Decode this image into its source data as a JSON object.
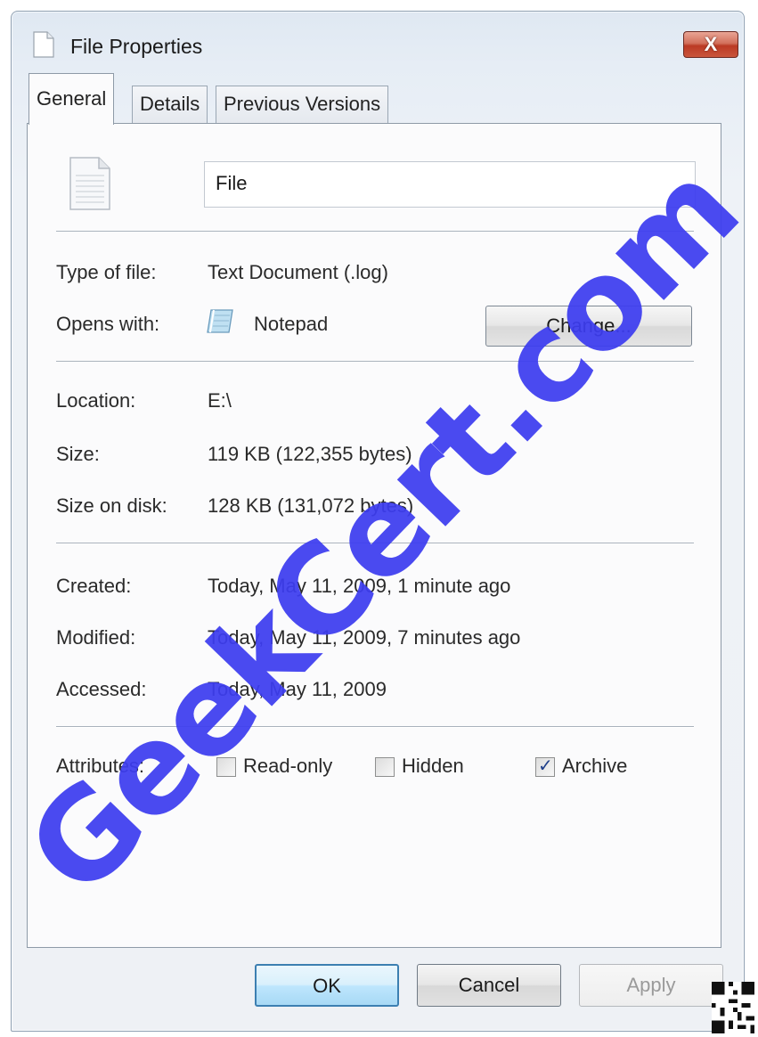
{
  "window": {
    "title": "File Properties",
    "close_label": "X"
  },
  "tabs": [
    {
      "label": "General",
      "selected": true
    },
    {
      "label": "Details",
      "selected": false
    },
    {
      "label": "Previous Versions",
      "selected": false
    }
  ],
  "general": {
    "file_name": "File",
    "type_label": "Type of file:",
    "type_value": "Text Document (.log)",
    "opens_label": "Opens with:",
    "opens_value": "Notepad",
    "opens_icon": "notepad-icon",
    "change_label": "Change...",
    "location_label": "Location:",
    "location_value": "E:\\",
    "size_label": "Size:",
    "size_value": "119 KB (122,355 bytes)",
    "size_disk_label": "Size on disk:",
    "size_disk_value": "128 KB (131,072 bytes)",
    "created_label": "Created:",
    "created_value": "Today, May 11, 2009, 1 minute ago",
    "modified_label": "Modified:",
    "modified_value": "Today, May 11, 2009, 7 minutes ago",
    "accessed_label": "Accessed:",
    "accessed_value": "Today, May 11, 2009",
    "attributes_label": "Attributes:",
    "attributes": [
      {
        "label": "Read-only",
        "checked": false
      },
      {
        "label": "Hidden",
        "checked": false
      },
      {
        "label": "Archive",
        "checked": true
      }
    ]
  },
  "buttons": {
    "ok": "OK",
    "cancel": "Cancel",
    "apply": "Apply",
    "apply_enabled": false
  },
  "watermark": {
    "text": "GeekCert.com",
    "color": "#3d3df0"
  },
  "colors": {
    "close_button": "#c4503a",
    "ok_button_border": "#3c7fb1"
  }
}
